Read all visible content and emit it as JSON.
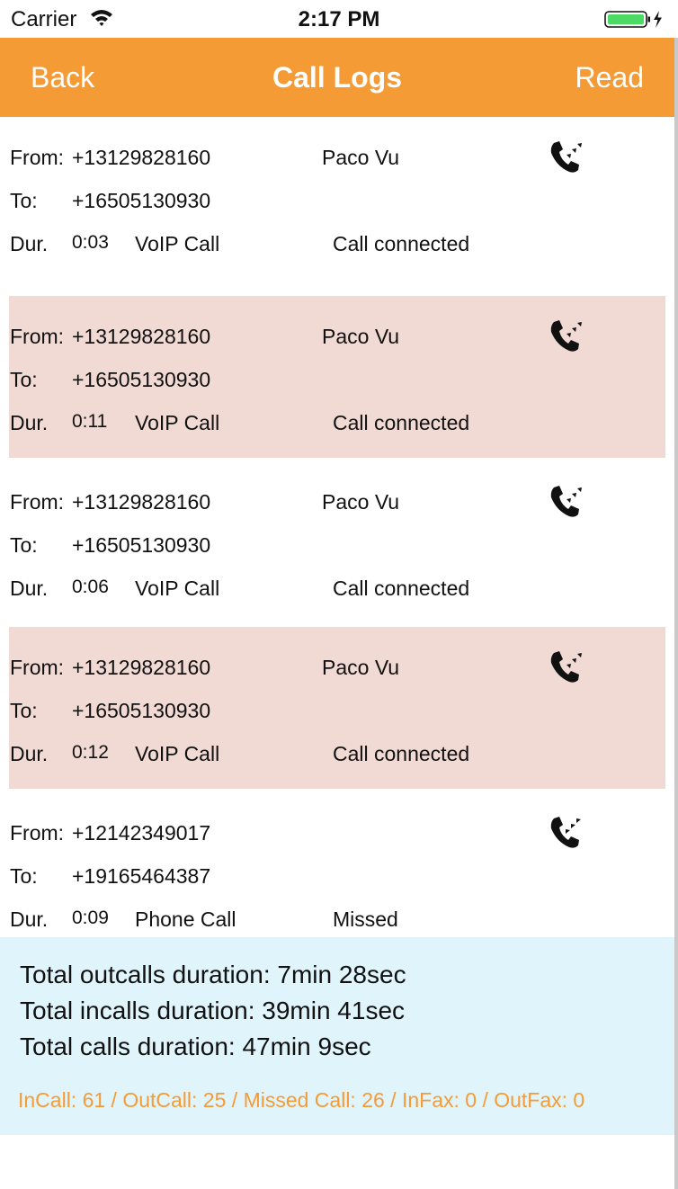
{
  "status_bar": {
    "carrier": "Carrier",
    "time": "2:17 PM"
  },
  "nav": {
    "back_label": "Back",
    "title": "Call Logs",
    "read_label": "Read"
  },
  "labels": {
    "from": "From:",
    "to": "To:",
    "dur": "Dur."
  },
  "calls": [
    {
      "from": "+13129828160",
      "name": "Paco Vu",
      "to": "+16505130930",
      "duration": "0:03",
      "type": "VoIP Call",
      "status": "Call connected",
      "icon": "outgoing-call-icon"
    },
    {
      "from": "+13129828160",
      "name": "Paco Vu",
      "to": "+16505130930",
      "duration": "0:11",
      "type": "VoIP Call",
      "status": "Call connected",
      "icon": "outgoing-call-icon"
    },
    {
      "from": "+13129828160",
      "name": "Paco Vu",
      "to": "+16505130930",
      "duration": "0:06",
      "type": "VoIP Call",
      "status": "Call connected",
      "icon": "outgoing-call-icon"
    },
    {
      "from": "+13129828160",
      "name": "Paco Vu",
      "to": "+16505130930",
      "duration": "0:12",
      "type": "VoIP Call",
      "status": "Call connected",
      "icon": "outgoing-call-icon"
    },
    {
      "from": "+12142349017",
      "name": "",
      "to": "+19165464387",
      "duration": "0:09",
      "type": "Phone Call",
      "status": "Missed",
      "icon": "incoming-call-icon"
    }
  ],
  "summary": {
    "outcalls": "Total outcalls duration: 7min 28sec",
    "incalls": "Total incalls duration: 39min 41sec",
    "total": "Total calls duration: 47min 9sec",
    "counts": "InCall: 61 / OutCall: 25 / Missed Call: 26 / InFax: 0 / OutFax: 0"
  },
  "colors": {
    "accent": "#f59b35",
    "row_shade": "#f1d9d4",
    "summary_bg": "#e0f4fc",
    "battery": "#4cd964"
  }
}
